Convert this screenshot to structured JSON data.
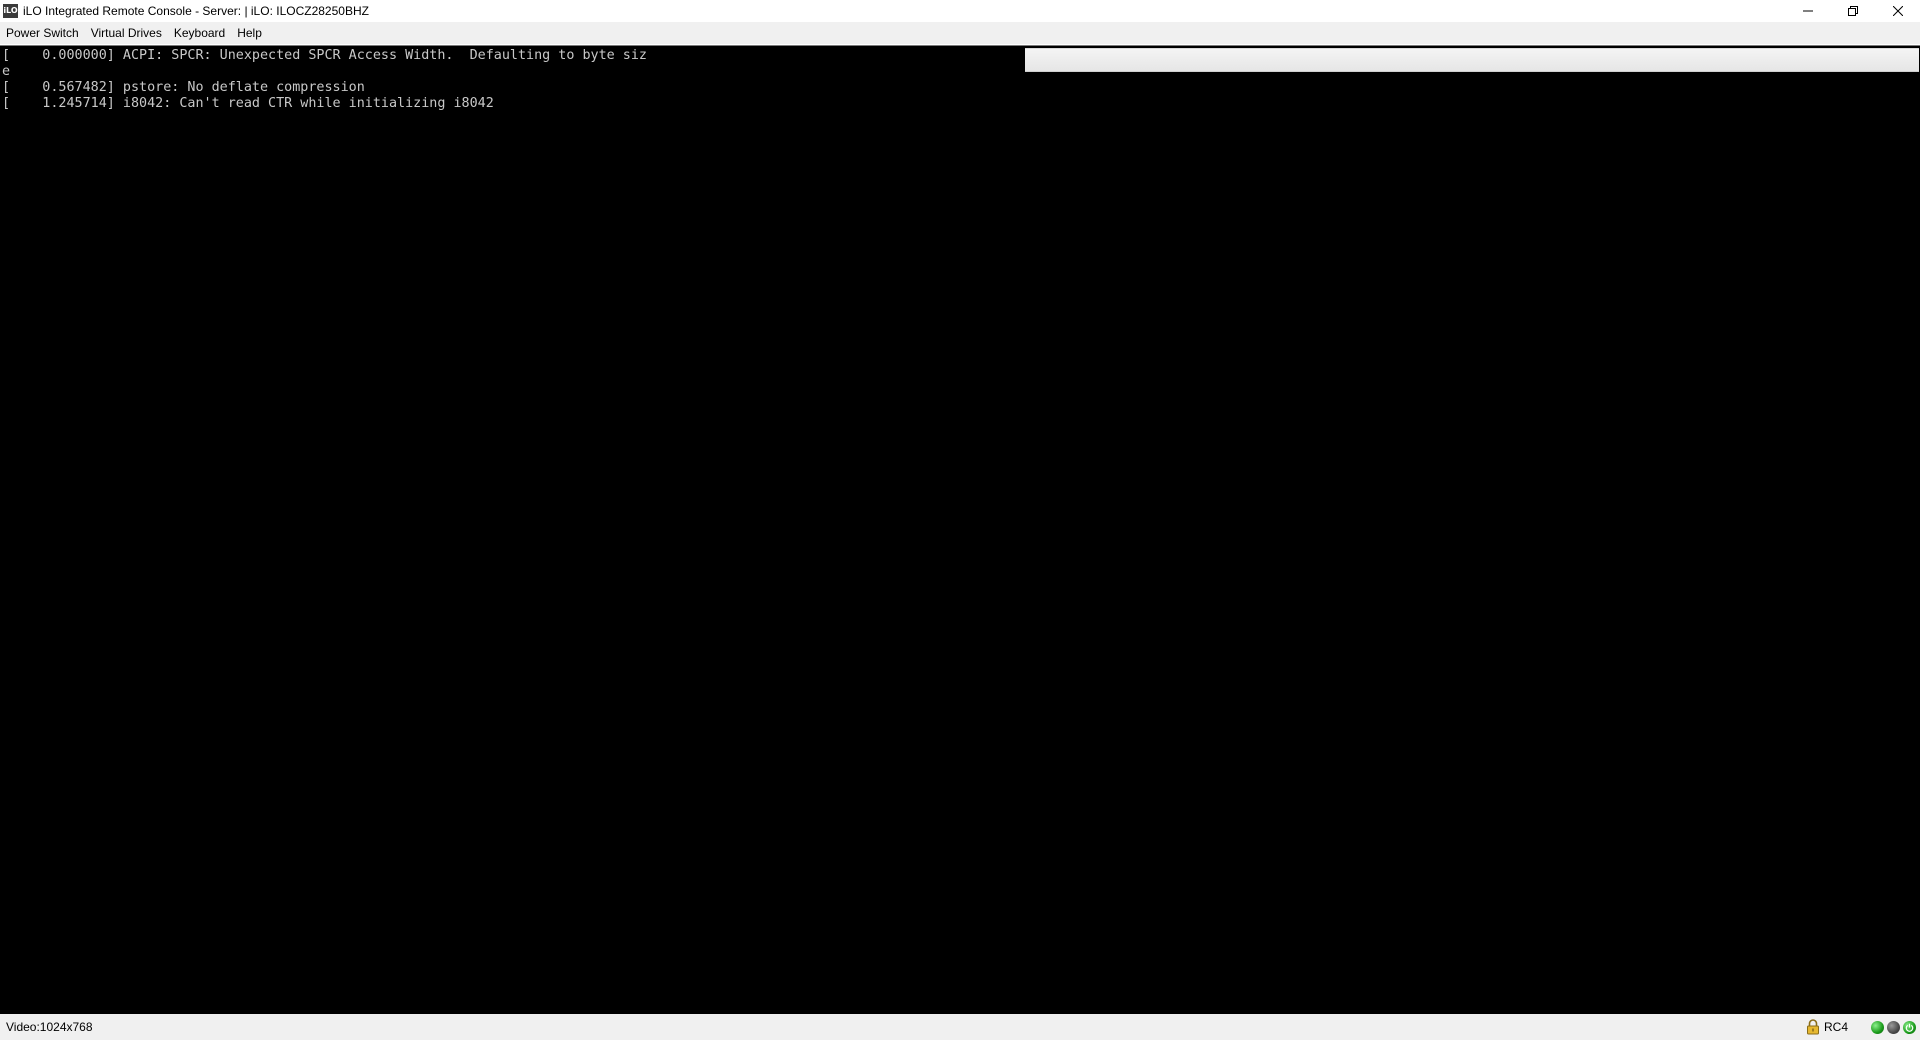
{
  "window": {
    "app_icon_text": "iLO",
    "title": "iLO Integrated Remote Console - Server:  | iLO: ILOCZ28250BHZ",
    "controls": {
      "minimize": "minimize-icon",
      "restore": "restore-icon",
      "close": "close-icon"
    }
  },
  "menubar": {
    "items": [
      {
        "label": "Power Switch"
      },
      {
        "label": "Virtual Drives"
      },
      {
        "label": "Keyboard"
      },
      {
        "label": "Help"
      }
    ]
  },
  "console": {
    "lines": [
      "[    0.000000] ACPI: SPCR: Unexpected SPCR Access Width.  Defaulting to byte siz",
      "e",
      "[    0.567482] pstore: No deflate compression",
      "[    1.245714] i8042: Can't read CTR while initializing i8042"
    ]
  },
  "statusbar": {
    "video": "Video:1024x768",
    "encryption": "RC4",
    "icons": [
      "lock-icon",
      "health-led-green",
      "activity-led-gray",
      "power-led-green"
    ]
  },
  "colors": {
    "console_bg": "#000000",
    "console_text": "#c8c8c8",
    "chrome_bg": "#f0f0f0",
    "led_green": "#1a9a1a"
  }
}
